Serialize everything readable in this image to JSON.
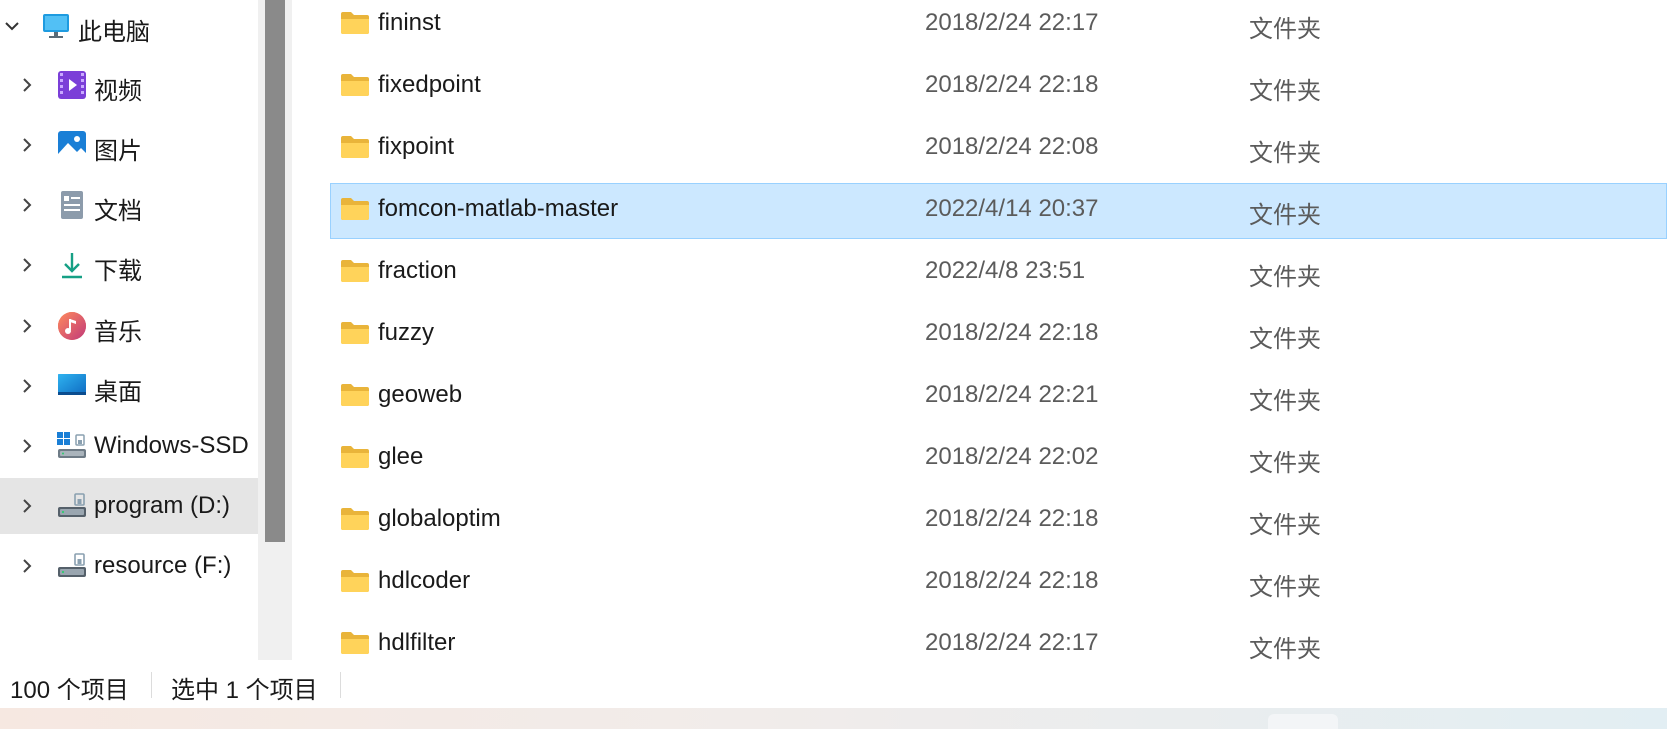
{
  "nav": {
    "root": {
      "label": "此电脑",
      "icon": "monitor-icon"
    },
    "items": [
      {
        "label": "视频",
        "icon": "video-icon"
      },
      {
        "label": "图片",
        "icon": "pictures-icon"
      },
      {
        "label": "文档",
        "icon": "documents-icon"
      },
      {
        "label": "下载",
        "icon": "download-icon"
      },
      {
        "label": "音乐",
        "icon": "music-icon"
      },
      {
        "label": "桌面",
        "icon": "desktop-icon"
      },
      {
        "label": "Windows-SSD",
        "icon": "windows-drive-icon"
      },
      {
        "label": "program (D:)",
        "icon": "drive-icon",
        "selected": true
      },
      {
        "label": "resource (F:)",
        "icon": "drive-icon"
      }
    ]
  },
  "files": [
    {
      "name": "fininst",
      "date": "2018/2/24 22:17",
      "type": "文件夹"
    },
    {
      "name": "fixedpoint",
      "date": "2018/2/24 22:18",
      "type": "文件夹"
    },
    {
      "name": "fixpoint",
      "date": "2018/2/24 22:08",
      "type": "文件夹"
    },
    {
      "name": "fomcon-matlab-master",
      "date": "2022/4/14 20:37",
      "type": "文件夹",
      "selected": true
    },
    {
      "name": "fraction",
      "date": "2022/4/8 23:51",
      "type": "文件夹"
    },
    {
      "name": "fuzzy",
      "date": "2018/2/24 22:18",
      "type": "文件夹"
    },
    {
      "name": "geoweb",
      "date": "2018/2/24 22:21",
      "type": "文件夹"
    },
    {
      "name": "glee",
      "date": "2018/2/24 22:02",
      "type": "文件夹"
    },
    {
      "name": "globaloptim",
      "date": "2018/2/24 22:18",
      "type": "文件夹"
    },
    {
      "name": "hdlcoder",
      "date": "2018/2/24 22:18",
      "type": "文件夹"
    },
    {
      "name": "hdlfilter",
      "date": "2018/2/24 22:17",
      "type": "文件夹"
    }
  ],
  "status": {
    "item_count": "100 个项目",
    "selected_count": "选中 1 个项目"
  },
  "colors": {
    "selection_bg": "#cce8ff",
    "selection_border": "#99d1ff",
    "folder": "#ffd35a",
    "nav_selected": "#e5e5e5"
  }
}
